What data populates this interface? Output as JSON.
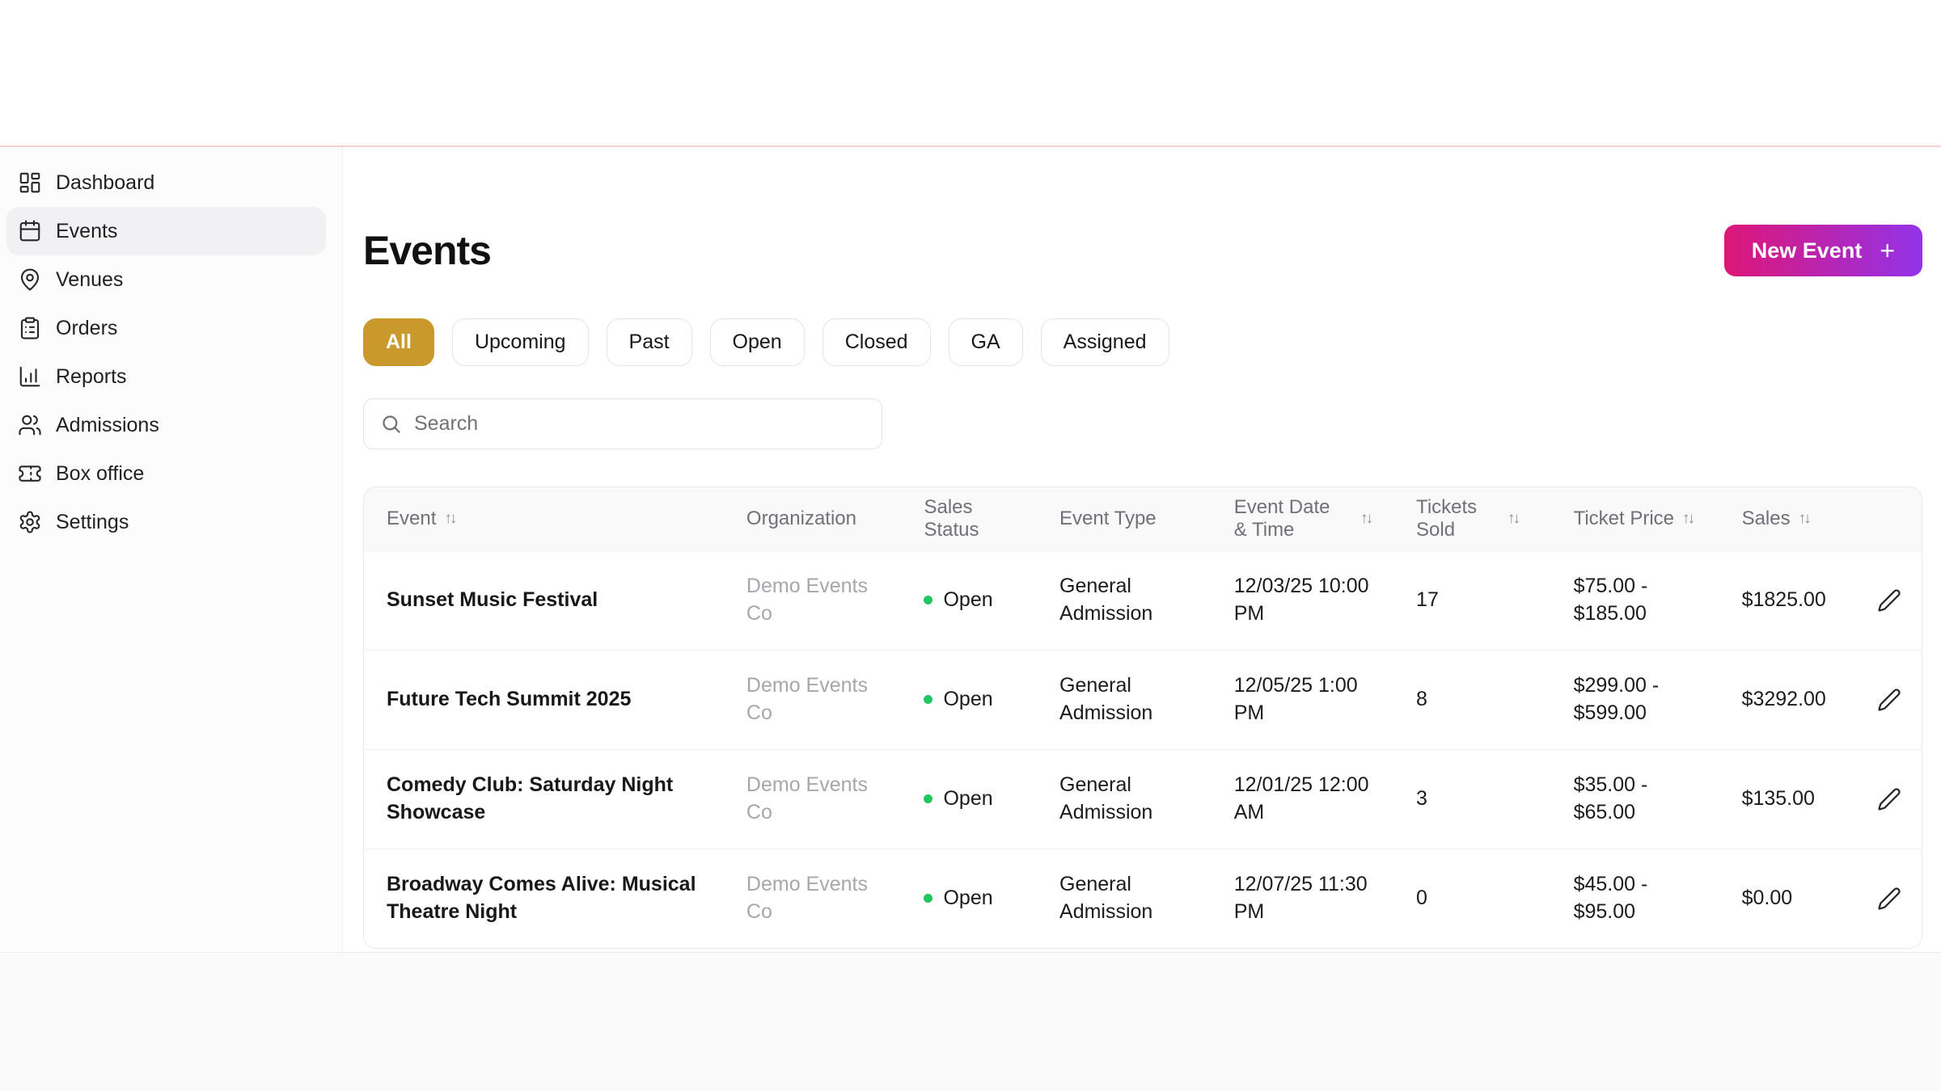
{
  "sidebar": {
    "items": [
      {
        "label": "Dashboard",
        "icon": "dashboard-icon"
      },
      {
        "label": "Events",
        "icon": "calendar-icon",
        "active": true
      },
      {
        "label": "Venues",
        "icon": "map-pin-icon"
      },
      {
        "label": "Orders",
        "icon": "clipboard-icon"
      },
      {
        "label": "Reports",
        "icon": "bar-chart-icon"
      },
      {
        "label": "Admissions",
        "icon": "users-icon"
      },
      {
        "label": "Box office",
        "icon": "ticket-icon"
      },
      {
        "label": "Settings",
        "icon": "gear-icon"
      }
    ]
  },
  "header": {
    "title": "Events",
    "new_event_label": "New Event",
    "new_event_plus": "+"
  },
  "filters": {
    "chips": [
      {
        "label": "All",
        "active": true
      },
      {
        "label": "Upcoming"
      },
      {
        "label": "Past"
      },
      {
        "label": "Open"
      },
      {
        "label": "Closed"
      },
      {
        "label": "GA"
      },
      {
        "label": "Assigned"
      }
    ]
  },
  "search": {
    "placeholder": "Search"
  },
  "table": {
    "sort_glyph": "↑↓",
    "columns": [
      {
        "label": "Event",
        "sortable": true
      },
      {
        "label": "Organization",
        "sortable": false
      },
      {
        "label": "Sales Status",
        "sortable": false
      },
      {
        "label": "Event Type",
        "sortable": false
      },
      {
        "label": "Event Date & Time",
        "sortable": true
      },
      {
        "label": "Tickets Sold",
        "sortable": true
      },
      {
        "label": "Ticket Price",
        "sortable": true
      },
      {
        "label": "Sales",
        "sortable": true
      }
    ],
    "rows": [
      {
        "name": "Sunset Music Festival",
        "org": "Demo Events Co",
        "status": "Open",
        "type": "General Admission",
        "datetime": "12/03/25 10:00 PM",
        "tickets_sold": "17",
        "price": "$75.00 - $185.00",
        "sales": "$1825.00"
      },
      {
        "name": "Future Tech Summit 2025",
        "org": "Demo Events Co",
        "status": "Open",
        "type": "General Admission",
        "datetime": "12/05/25 1:00 PM",
        "tickets_sold": "8",
        "price": "$299.00 - $599.00",
        "sales": "$3292.00"
      },
      {
        "name": "Comedy Club: Saturday Night Showcase",
        "org": "Demo Events Co",
        "status": "Open",
        "type": "General Admission",
        "datetime": "12/01/25 12:00 AM",
        "tickets_sold": "3",
        "price": "$35.00 - $65.00",
        "sales": "$135.00"
      },
      {
        "name": "Broadway Comes Alive: Musical Theatre Night",
        "org": "Demo Events Co",
        "status": "Open",
        "type": "General Admission",
        "datetime": "12/07/25 11:30 PM",
        "tickets_sold": "0",
        "price": "$45.00 - $95.00",
        "sales": "$0.00"
      }
    ]
  },
  "colors": {
    "accent_gold": "#C9992B",
    "button_gradient_from": "#DE1677",
    "button_gradient_to": "#9333EA",
    "status_open_dot": "#22C55E",
    "top_divider_pink": "#F3D2CE"
  }
}
